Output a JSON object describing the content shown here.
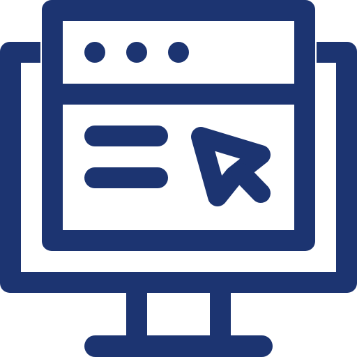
{
  "icon": {
    "name": "computer-browser-cursor-icon",
    "color": "#1c3471",
    "background": "#ffffff"
  }
}
